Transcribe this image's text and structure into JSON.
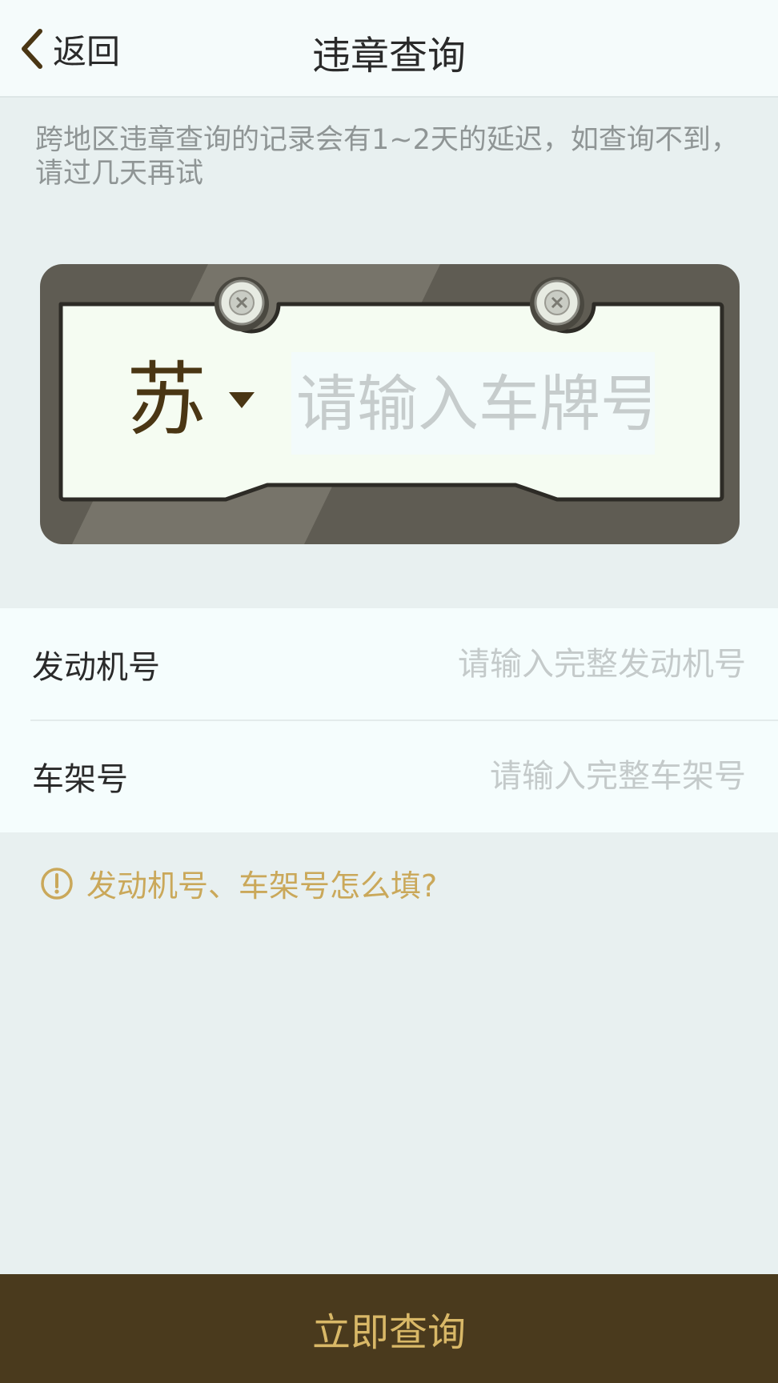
{
  "header": {
    "back_label": "返回",
    "title": "违章查询"
  },
  "notice": "跨地区违章查询的记录会有1~2天的延迟，如查询不到，请过几天再试",
  "plate": {
    "province": "苏",
    "number_placeholder": "请输入车牌号",
    "number_value": ""
  },
  "form": {
    "engine": {
      "label": "发动机号",
      "placeholder": "请输入完整发动机号"
    },
    "frame": {
      "label": "车架号",
      "placeholder": "请输入完整车架号"
    }
  },
  "help": {
    "text": "发动机号、车架号怎么填?"
  },
  "submit_label": "立即查询",
  "colors": {
    "accent": "#caa85a",
    "button_bg": "#4a3a1d",
    "button_text": "#d9b867",
    "plate_frame": "#5f5c53",
    "plate_face": "#f5fcf2",
    "province_text": "#4a3614"
  },
  "icons": {
    "back": "chevron-left-icon",
    "dropdown": "caret-down-icon",
    "screw": "screw-icon",
    "help": "info-icon"
  }
}
